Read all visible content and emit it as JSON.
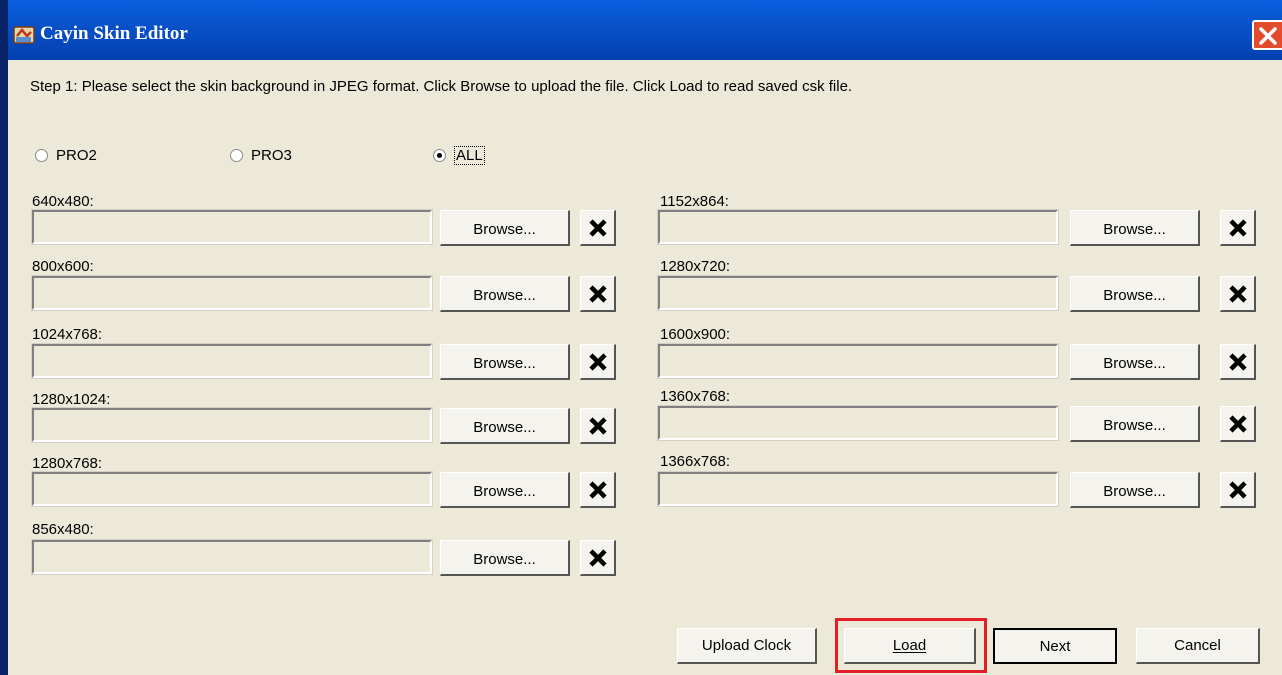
{
  "window": {
    "title": "Cayin Skin Editor"
  },
  "step_text": "Step 1: Please select the skin background in JPEG format. Click Browse to upload the file. Click Load to read saved csk file.",
  "radios": [
    {
      "label": "PRO2",
      "checked": false
    },
    {
      "label": "PRO3",
      "checked": false
    },
    {
      "label": "ALL",
      "checked": true
    }
  ],
  "browse_label": "Browse...",
  "left_resolutions": [
    {
      "label": "640x480:",
      "value": ""
    },
    {
      "label": "800x600:",
      "value": ""
    },
    {
      "label": "1024x768:",
      "value": ""
    },
    {
      "label": "1280x1024:",
      "value": ""
    },
    {
      "label": "1280x768:",
      "value": ""
    },
    {
      "label": "856x480:",
      "value": ""
    }
  ],
  "right_resolutions": [
    {
      "label": "1152x864:",
      "value": ""
    },
    {
      "label": "1280x720:",
      "value": ""
    },
    {
      "label": "1600x900:",
      "value": ""
    },
    {
      "label": "1360x768:",
      "value": ""
    },
    {
      "label": "1366x768:",
      "value": ""
    }
  ],
  "buttons": {
    "upload_clock": "Upload Clock",
    "load": "Load",
    "next": "Next",
    "cancel": "Cancel"
  },
  "colors": {
    "highlight": "#e31e24",
    "titlebar": "#0a5fe0",
    "face": "#ece9d8"
  }
}
